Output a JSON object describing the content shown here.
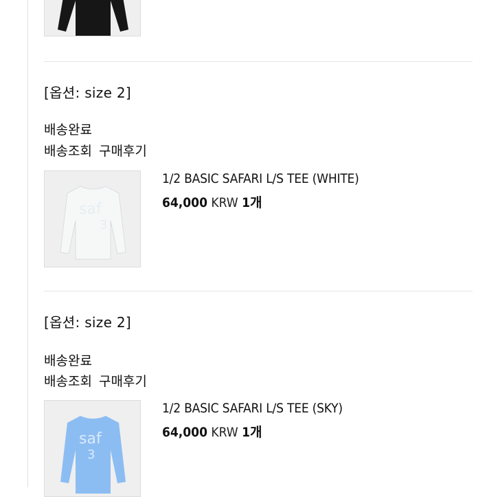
{
  "orders": [
    {
      "option": "[옵션: size 2]",
      "status": "배송완료",
      "track_link": "배송조회",
      "review_link": "구매후기",
      "title": "1/2 BASIC SAFARI L/S TEE (WHITE)",
      "price": "64,000",
      "currency": "KRW",
      "qty": "1개",
      "thumb_text_1": "saf",
      "thumb_text_2": "3",
      "shirt_color": "#f6f8f8",
      "print_color": "#eef3f4"
    },
    {
      "option": "[옵션: size 2]",
      "status": "배송완료",
      "track_link": "배송조회",
      "review_link": "구매후기",
      "title": "1/2 BASIC SAFARI L/S TEE (SKY)",
      "price": "64,000",
      "currency": "KRW",
      "qty": "1개",
      "thumb_text_1": "saf",
      "thumb_text_2": "3",
      "shirt_color": "#8cbdf2",
      "print_color": "#dbeafb"
    }
  ],
  "top_item": {
    "shirt_color": "#161616"
  }
}
